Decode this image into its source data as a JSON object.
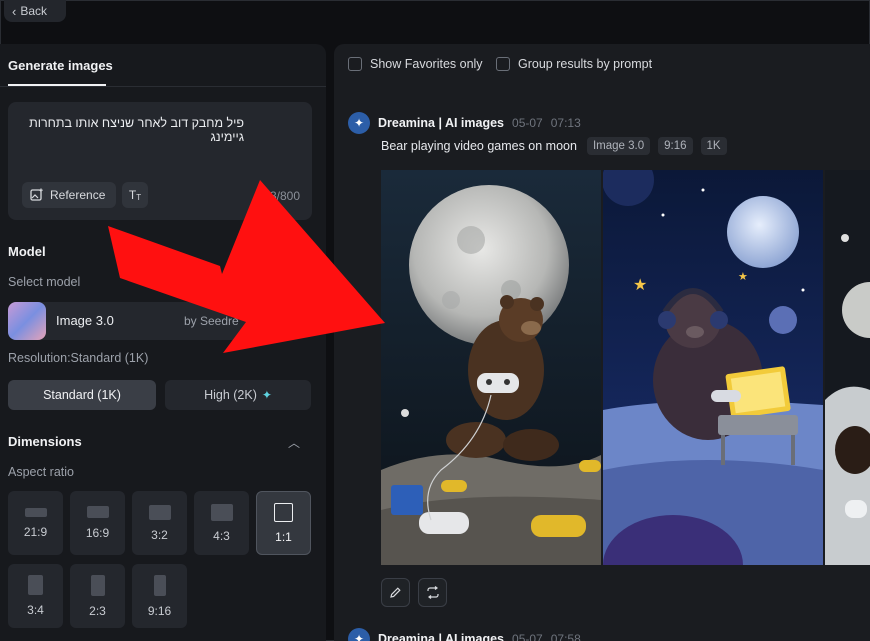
{
  "back": {
    "label": "Back"
  },
  "left_panel": {
    "tab": "Generate images",
    "prompt": {
      "text": "פיל מחבק דוב לאחר שניצח אותו בתחרות גיימינג",
      "reference_label": "Reference",
      "text_tool_label": "T",
      "counter": "43/800"
    },
    "model": {
      "section_title": "Model",
      "select_label": "Select model",
      "name": "Image 3.0",
      "by": "by Seedre"
    },
    "resolution": {
      "label": "Resolution:Standard (1K)",
      "standard": "Standard (1K)",
      "high": "High (2K)",
      "selected": "Standard (1K)"
    },
    "dimensions": {
      "section_title": "Dimensions",
      "aspect_label": "Aspect ratio",
      "ratios": [
        "21:9",
        "16:9",
        "3:2",
        "4:3",
        "1:1",
        "3:4",
        "2:3",
        "9:16"
      ],
      "selected": "1:1"
    }
  },
  "right_panel": {
    "filters": {
      "favorites": "Show Favorites only",
      "group": "Group results by prompt"
    },
    "generation": {
      "source": "Dreamina | AI images",
      "date": "05-07",
      "time": "07:13",
      "prompt": "Bear playing video games on moon",
      "tags": [
        "Image 3.0",
        "9:16",
        "1K"
      ]
    },
    "next_generation": {
      "source": "Dreamina | AI images",
      "date": "05-07",
      "time": "07:58"
    }
  },
  "icons": {
    "back": "chevron-left-icon",
    "reference": "image-plus-icon",
    "text_tool": "text-size-icon",
    "sparkle": "sparkle-icon",
    "collapse": "chevron-up-icon",
    "brand": "dreamina-logo-icon",
    "edit": "pencil-icon",
    "regenerate": "repeat-icon",
    "arrow": "red-arrow-annotation"
  },
  "colors": {
    "accent": "#5fd3e0",
    "arrow": "#ff1010",
    "background": "#0e0f12"
  }
}
